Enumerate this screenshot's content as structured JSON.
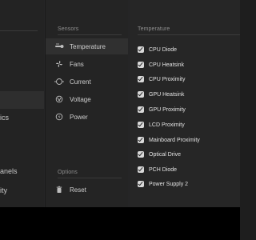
{
  "left_column": {
    "items": [
      {
        "label": "ics"
      },
      {
        "label": "anels"
      },
      {
        "label": "ity"
      }
    ]
  },
  "sensors": {
    "header": "Sensors",
    "items": [
      {
        "label": "Temperature",
        "icon": "thermometer-icon",
        "selected": true
      },
      {
        "label": "Fans",
        "icon": "fan-icon",
        "selected": false
      },
      {
        "label": "Current",
        "icon": "current-icon",
        "selected": false
      },
      {
        "label": "Voltage",
        "icon": "voltage-icon",
        "selected": false
      },
      {
        "label": "Power",
        "icon": "power-icon",
        "selected": false
      }
    ],
    "options_header": "Options",
    "reset_label": "Reset"
  },
  "temperature": {
    "header": "Temperature",
    "rows": [
      {
        "label": "CPU Diode",
        "checked": true
      },
      {
        "label": "CPU Heatsink",
        "checked": true
      },
      {
        "label": "CPU Proximity",
        "checked": true
      },
      {
        "label": "GPU Heatsink",
        "checked": true
      },
      {
        "label": "GPU Proximity",
        "checked": true
      },
      {
        "label": "LCD Proximity",
        "checked": true
      },
      {
        "label": "Mainboard Proximity",
        "checked": true
      },
      {
        "label": "Optical Drive",
        "checked": true
      },
      {
        "label": "PCH Diode",
        "checked": true
      },
      {
        "label": "Power Supply 2",
        "checked": true
      }
    ]
  },
  "colors": {
    "background": "#252526",
    "selected_row": "#303030",
    "checkbox": "#d9d9d9",
    "bottom_bar": "#000000"
  }
}
